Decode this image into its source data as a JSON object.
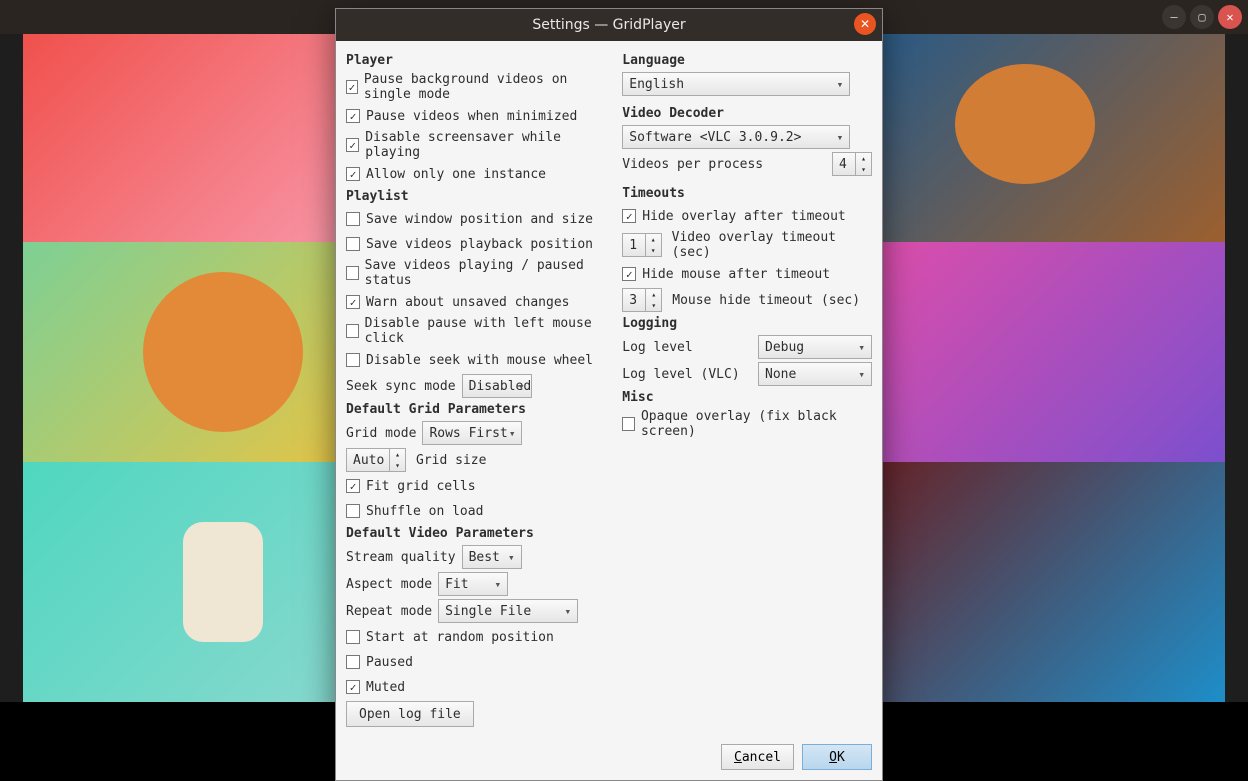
{
  "outer_window": {
    "minimize_icon": "minimize-icon",
    "maximize_icon": "maximize-icon",
    "close_icon": "close-icon"
  },
  "dialog": {
    "title": "Settings — GridPlayer",
    "close_icon": "close-icon"
  },
  "left": {
    "player_h": "Player",
    "pause_bg": {
      "label": "Pause background videos on single mode",
      "checked": true
    },
    "pause_min": {
      "label": "Pause videos when minimized",
      "checked": true
    },
    "disable_ss": {
      "label": "Disable screensaver while playing",
      "checked": true
    },
    "allow_one": {
      "label": "Allow only one instance",
      "checked": true
    },
    "playlist_h": "Playlist",
    "save_win": {
      "label": "Save window position and size",
      "checked": false
    },
    "save_pb": {
      "label": "Save videos playback position",
      "checked": false
    },
    "save_status": {
      "label": "Save videos playing / paused status",
      "checked": false
    },
    "warn_unsaved": {
      "label": "Warn about unsaved changes",
      "checked": true
    },
    "disable_pause_click": {
      "label": "Disable pause with left mouse click",
      "checked": false
    },
    "disable_seek_wheel": {
      "label": "Disable seek with mouse wheel",
      "checked": false
    },
    "seek_sync_label": "Seek sync mode",
    "seek_sync_value": "Disabled",
    "grid_params_h": "Default Grid Parameters",
    "grid_mode_label": "Grid mode",
    "grid_mode_value": "Rows First",
    "grid_size_value": "Auto",
    "grid_size_label": "Grid size",
    "fit_cells": {
      "label": "Fit grid cells",
      "checked": true
    },
    "shuffle": {
      "label": "Shuffle on load",
      "checked": false
    },
    "video_params_h": "Default Video Parameters",
    "stream_q_label": "Stream quality",
    "stream_q_value": "Best",
    "aspect_label": "Aspect mode",
    "aspect_value": "Fit",
    "repeat_label": "Repeat mode",
    "repeat_value": "Single File",
    "start_rand": {
      "label": "Start at random position",
      "checked": false
    },
    "paused": {
      "label": "Paused",
      "checked": false
    },
    "muted": {
      "label": "Muted",
      "checked": true
    },
    "open_log_btn": "Open log file"
  },
  "right": {
    "language_h": "Language",
    "language_value": "English",
    "decoder_h": "Video Decoder",
    "decoder_value": "Software <VLC 3.0.9.2>",
    "vpp_label": "Videos per process",
    "vpp_value": "4",
    "timeouts_h": "Timeouts",
    "hide_overlay": {
      "label": "Hide overlay after timeout",
      "checked": true
    },
    "video_overlay_value": "1",
    "video_overlay_label": "Video overlay timeout (sec)",
    "hide_mouse": {
      "label": "Hide mouse after timeout",
      "checked": true
    },
    "mouse_hide_value": "3",
    "mouse_hide_label": "Mouse hide timeout (sec)",
    "logging_h": "Logging",
    "log_level_label": "Log level",
    "log_level_value": "Debug",
    "log_level_vlc_label": "Log level (VLC)",
    "log_level_vlc_value": "None",
    "misc_h": "Misc",
    "opaque": {
      "label": "Opaque overlay (fix black screen)",
      "checked": false
    }
  },
  "footer": {
    "cancel": "Cancel",
    "ok": "OK"
  }
}
